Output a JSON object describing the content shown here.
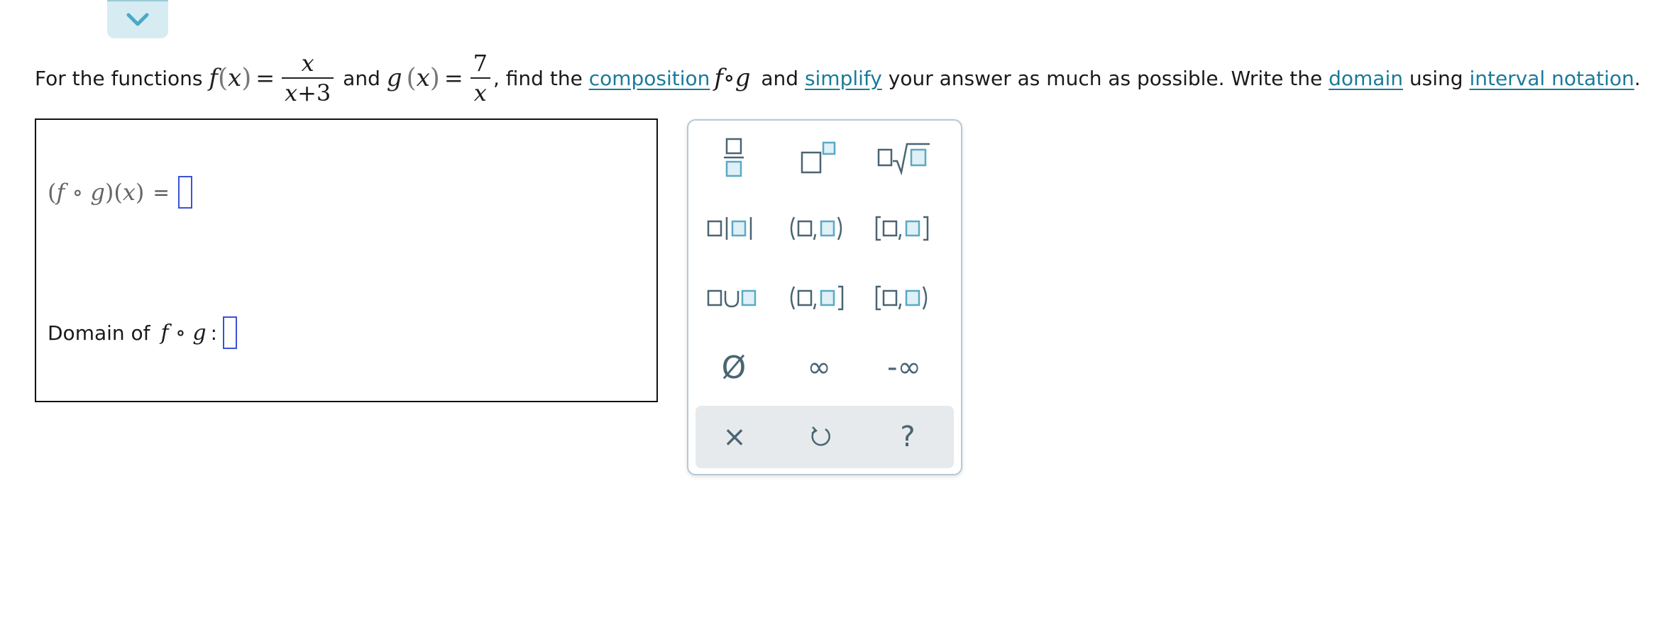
{
  "question": {
    "prefix": "For the functions ",
    "f_name": "f",
    "x_var": "x",
    "f_num": "x",
    "f_den": "x+3",
    "and_1": " and ",
    "g_name": "g",
    "g_num": "7",
    "g_den": "x",
    "comma_find": ", find the ",
    "link_composition": "composition",
    "and_2": " and ",
    "link_simplify": "simplify",
    "middle": " your answer as much as possible. Write the ",
    "link_domain": "domain",
    "using": " using ",
    "link_interval_notation": "interval notation",
    "period": "."
  },
  "answer": {
    "fog_label_f": "f",
    "fog_label_g": "g",
    "fog_label_x": "x",
    "equals": "=",
    "domain_label": "Domain of ",
    "domain_f": "f",
    "domain_g": "g",
    "domain_colon": ":"
  },
  "palette": {
    "buttons": [
      {
        "name": "fraction",
        "icon": "fraction-icon"
      },
      {
        "name": "superscript",
        "icon": "superscript-icon"
      },
      {
        "name": "nth-root",
        "icon": "nth-root-icon"
      },
      {
        "name": "or",
        "icon": "vertical-bar-icon"
      },
      {
        "name": "open-interval",
        "icon": "open-interval-icon"
      },
      {
        "name": "closed-interval",
        "icon": "closed-interval-icon"
      },
      {
        "name": "union",
        "icon": "union-icon"
      },
      {
        "name": "left-open-right-closed",
        "icon": "half-open-left-icon"
      },
      {
        "name": "left-closed-right-open",
        "icon": "half-open-right-icon"
      },
      {
        "name": "empty-set",
        "icon": "empty-set-icon",
        "glyph": "Ø"
      },
      {
        "name": "infinity",
        "icon": "infinity-icon",
        "glyph": "∞"
      },
      {
        "name": "negative-infinity",
        "icon": "negative-infinity-icon",
        "glyph": "-∞"
      }
    ],
    "footer": [
      {
        "name": "clear",
        "icon": "close-icon",
        "glyph": "×"
      },
      {
        "name": "undo",
        "icon": "undo-icon"
      },
      {
        "name": "help",
        "icon": "help-icon",
        "glyph": "?"
      }
    ],
    "colors": {
      "icon": "#4a6472",
      "accent": "#5aa9c4",
      "footer_bg": "#e6eaec"
    }
  }
}
